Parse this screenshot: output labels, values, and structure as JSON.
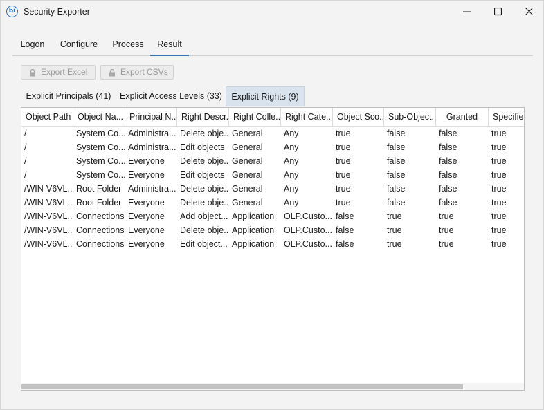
{
  "window": {
    "title": "Security Exporter",
    "app_icon_text": "bi"
  },
  "main_tabs": [
    {
      "label": "Logon"
    },
    {
      "label": "Configure"
    },
    {
      "label": "Process"
    },
    {
      "label": "Result",
      "active": true
    }
  ],
  "toolbar": {
    "export_excel_label": "Export Excel",
    "export_csvs_label": "Export CSVs"
  },
  "sub_tabs": [
    {
      "label": "Explicit Principals (41)"
    },
    {
      "label": "Explicit Access Levels (33)"
    },
    {
      "label": "Explicit Rights (9)",
      "active": true
    }
  ],
  "table": {
    "columns": [
      "Object Path",
      "Object Na...",
      "Principal N...",
      "Right Descr...",
      "Right Colle...",
      "Right Cate...",
      "Object Sco...",
      "Sub-Object...",
      "Granted",
      "Specifie"
    ],
    "rows": [
      [
        "/",
        "System Co...",
        "Administra...",
        "Delete obje...",
        "General",
        "Any",
        "true",
        "false",
        "false",
        "true"
      ],
      [
        "/",
        "System Co...",
        "Administra...",
        "Edit objects",
        "General",
        "Any",
        "true",
        "false",
        "false",
        "true"
      ],
      [
        "/",
        "System Co...",
        "Everyone",
        "Delete obje...",
        "General",
        "Any",
        "true",
        "false",
        "false",
        "true"
      ],
      [
        "/",
        "System Co...",
        "Everyone",
        "Edit objects",
        "General",
        "Any",
        "true",
        "false",
        "false",
        "true"
      ],
      [
        "/WIN-V6VL...",
        "Root Folder",
        "Administra...",
        "Delete obje...",
        "General",
        "Any",
        "true",
        "false",
        "false",
        "true"
      ],
      [
        "/WIN-V6VL...",
        "Root Folder",
        "Everyone",
        "Delete obje...",
        "General",
        "Any",
        "true",
        "false",
        "false",
        "true"
      ],
      [
        "/WIN-V6VL...",
        "Connections",
        "Everyone",
        "Add object...",
        "Application",
        "OLP.Custo...",
        "false",
        "true",
        "true",
        "true"
      ],
      [
        "/WIN-V6VL...",
        "Connections",
        "Everyone",
        "Delete obje...",
        "Application",
        "OLP.Custo...",
        "false",
        "true",
        "true",
        "true"
      ],
      [
        "/WIN-V6VL...",
        "Connections",
        "Everyone",
        "Edit object...",
        "Application",
        "OLP.Custo...",
        "false",
        "true",
        "true",
        "true"
      ]
    ]
  }
}
